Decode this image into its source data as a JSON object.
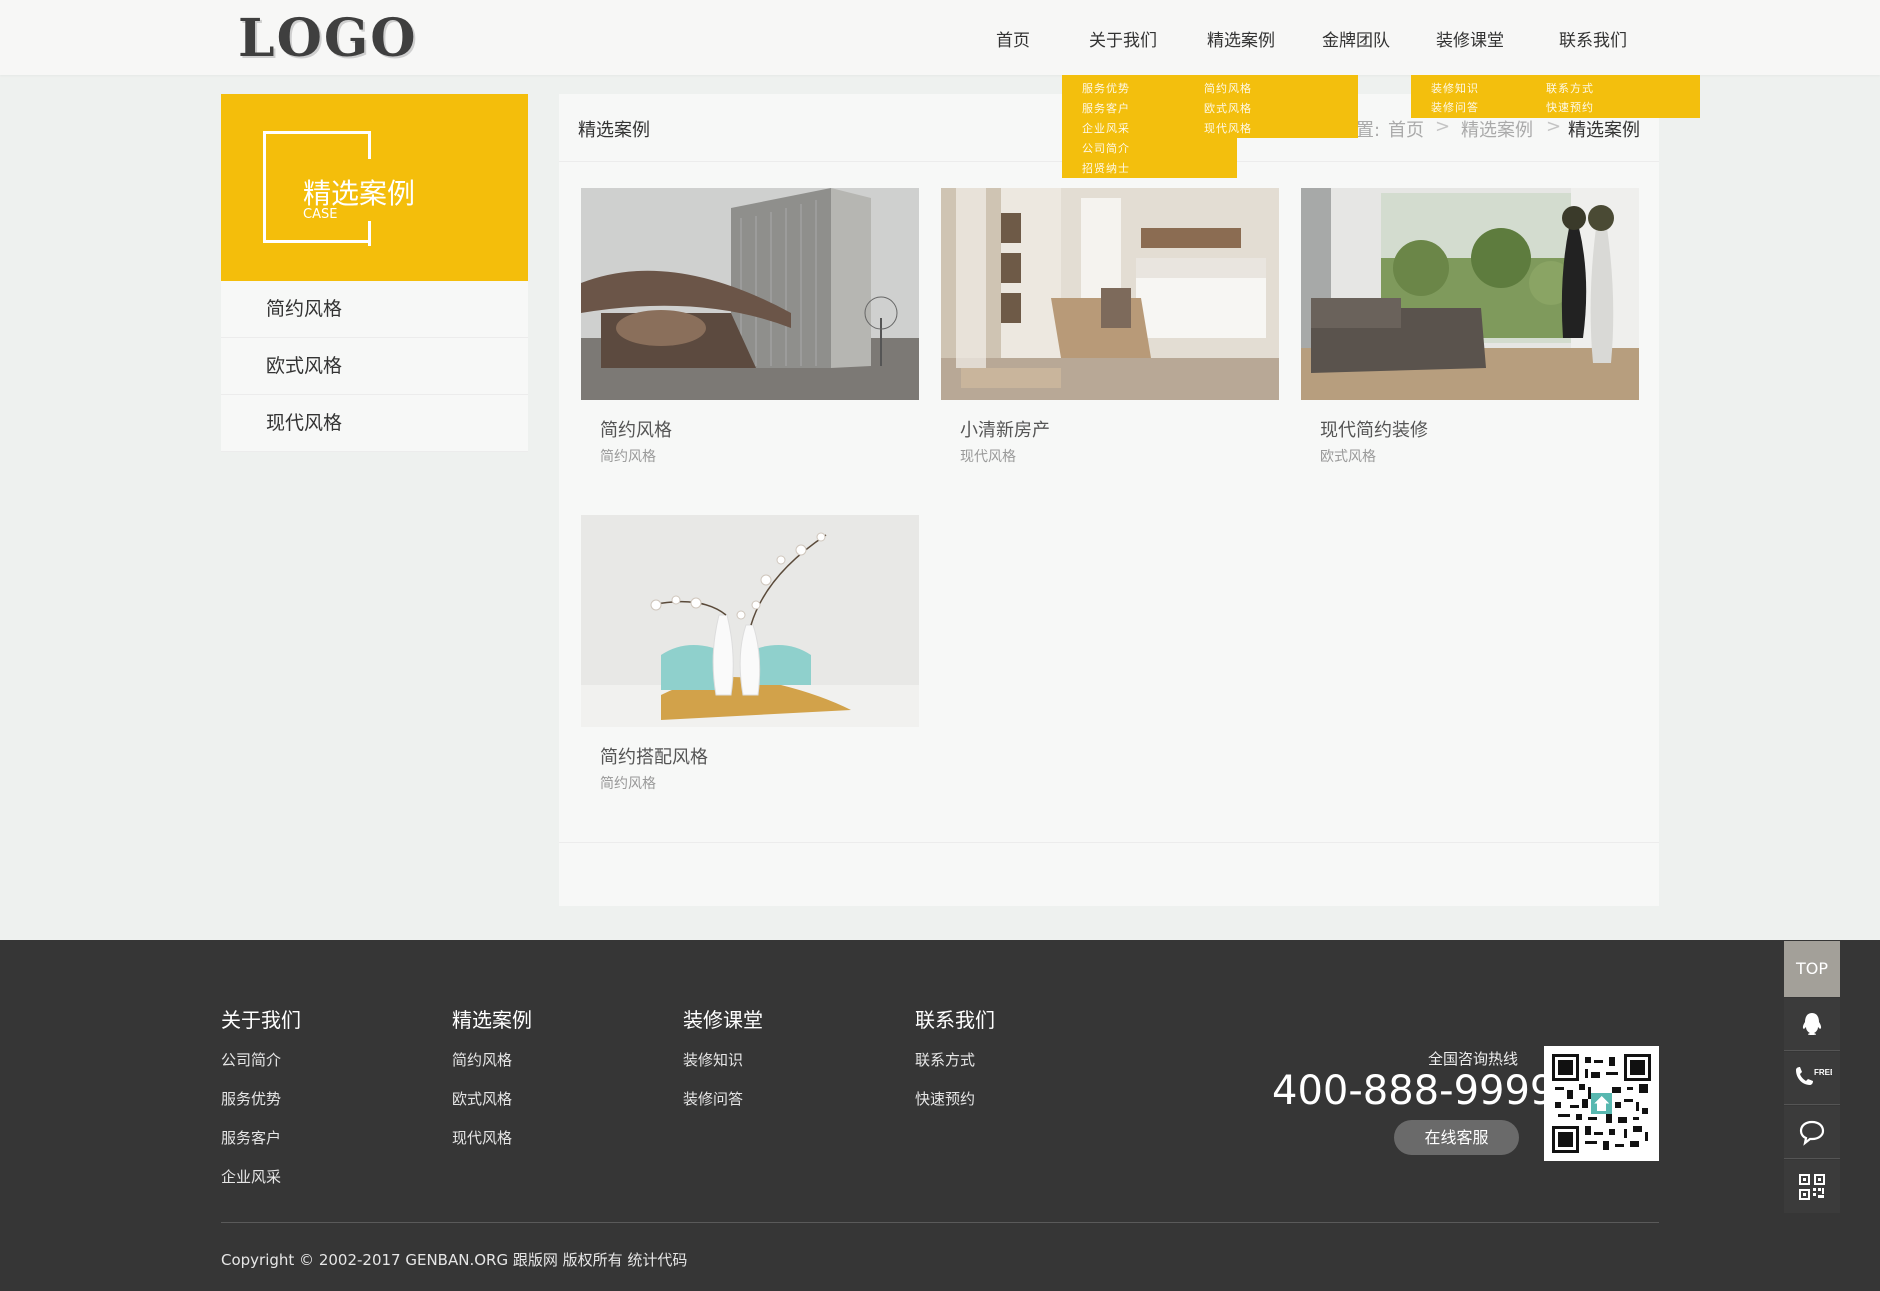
{
  "header": {
    "logo": "LOGO",
    "nav": [
      {
        "label": "首页"
      },
      {
        "label": "关于我们"
      },
      {
        "label": "精选案例"
      },
      {
        "label": "金牌团队"
      },
      {
        "label": "装修课堂"
      },
      {
        "label": "联系我们"
      }
    ],
    "dropdown_about": [
      "服务优势",
      "服务客户",
      "企业风采",
      "公司简介",
      "招贤纳士"
    ],
    "dropdown_cases": [
      "简约风格",
      "欧式风格",
      "现代风格"
    ],
    "dropdown_class": [
      "装修知识",
      "装修问答"
    ],
    "dropdown_contact": [
      "联系方式",
      "快速预约"
    ]
  },
  "sidebar": {
    "title": "精选案例",
    "subtitle": "CASE",
    "items": [
      {
        "label": "简约风格"
      },
      {
        "label": "欧式风格"
      },
      {
        "label": "现代风格"
      }
    ]
  },
  "main": {
    "caption": "精选案例",
    "breadcrumb": {
      "prefix": "置:",
      "items": [
        "首页",
        "精选案例",
        "精选案例"
      ],
      "sep": ">"
    },
    "cards": [
      {
        "title": "简约风格",
        "category": "简约风格"
      },
      {
        "title": "小清新房产",
        "category": "现代风格"
      },
      {
        "title": "现代简约装修",
        "category": "欧式风格"
      },
      {
        "title": "简约搭配风格",
        "category": "简约风格"
      }
    ]
  },
  "footer": {
    "cols": [
      {
        "title": "关于我们",
        "links": [
          "公司简介",
          "服务优势",
          "服务客户",
          "企业风采"
        ]
      },
      {
        "title": "精选案例",
        "links": [
          "简约风格",
          "欧式风格",
          "现代风格"
        ]
      },
      {
        "title": "装修课堂",
        "links": [
          "装修知识",
          "装修问答"
        ]
      },
      {
        "title": "联系我们",
        "links": [
          "联系方式",
          "快速预约"
        ]
      }
    ],
    "hotline_label": "全国咨询热线",
    "hotline": "400-888-9999",
    "online_button": "在线客服",
    "copyright": "Copyright © 2002-2017 GENBAN.ORG 跟版网 版权所有  统计代码"
  },
  "floating": {
    "top": "TOP",
    "icons": [
      "qq-icon",
      "free-phone-icon",
      "chat-icon",
      "qrcode-icon"
    ],
    "free_label": "FREE"
  },
  "colors": {
    "accent": "#f4be0b",
    "footer_bg": "#363636"
  }
}
